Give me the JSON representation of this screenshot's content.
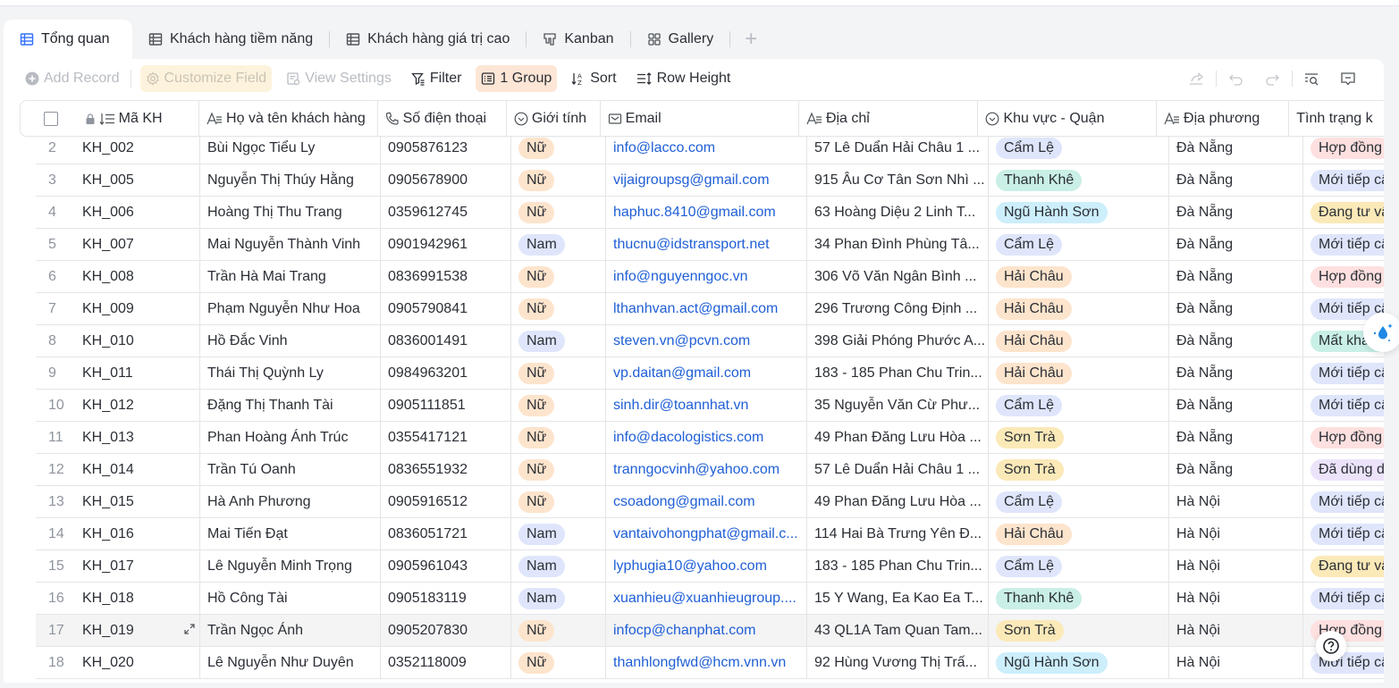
{
  "tabs": [
    {
      "label": "Tổng quan",
      "icon": "grid-table-icon",
      "active": true
    },
    {
      "label": "Khách hàng tiềm năng",
      "icon": "grid-table-icon"
    },
    {
      "label": "Khách hàng giá trị cao",
      "icon": "grid-table-icon"
    },
    {
      "label": "Kanban",
      "icon": "kanban-icon"
    },
    {
      "label": "Gallery",
      "icon": "gallery-icon"
    }
  ],
  "add_tab_label": "+",
  "toolbar": {
    "add_record": "Add Record",
    "customize_field": "Customize Field",
    "view_settings": "View Settings",
    "filter": "Filter",
    "group": "1 Group",
    "sort": "Sort",
    "row_height": "Row Height"
  },
  "columns": {
    "code": "Mã KH",
    "name": "Họ và tên khách hàng",
    "phone": "Số điện thoại",
    "gender": "Giới tính",
    "email": "Email",
    "address": "Địa chỉ",
    "district": "Khu vực - Quận",
    "locality": "Địa phương",
    "status": "Tình trạng k"
  },
  "tag_colors": {
    "Nữ": "#fde4cc",
    "Nam": "#dfe6fb",
    "Cẩm Lệ": "#dfe6fb",
    "Thanh Khê": "#c9efe6",
    "Ngũ Hành Sơn": "#cdeefb",
    "Hải Châu": "#fde4cc",
    "Sơn Trà": "#fbe9b8",
    "Hợp đồng": "#fde0df",
    "Mới tiếp cậ": "#dfe6fb",
    "Đang tư vấ": "#fbe9b8",
    "Mất khách": "#c9efe6",
    "Đã dùng d": "#ece3fb"
  },
  "rows": [
    {
      "n": "2",
      "code": "KH_002",
      "name": "Bùi Ngọc Tiểu Ly",
      "phone": "0905876123",
      "gender": "Nữ",
      "email": "info@lacco.com",
      "address": "57 Lê Duẩn Hải Châu 1 ...",
      "district": "Cẩm Lệ",
      "locality": "Đà Nẵng",
      "status": "Hợp đồng"
    },
    {
      "n": "3",
      "code": "KH_005",
      "name": "Nguyễn Thị Thúy Hằng",
      "phone": "0905678900",
      "gender": "Nữ",
      "email": "vijaigroupsg@gmail.com",
      "address": "915 Âu Cơ Tân Sơn Nhì ...",
      "district": "Thanh Khê",
      "locality": "Đà Nẵng",
      "status": "Mới tiếp cậ"
    },
    {
      "n": "4",
      "code": "KH_006",
      "name": "Hoàng Thị Thu Trang",
      "phone": "0359612745",
      "gender": "Nữ",
      "email": "haphuc.8410@gmail.com",
      "address": "63 Hoàng Diệu 2 Linh T...",
      "district": "Ngũ Hành Sơn",
      "locality": "Đà Nẵng",
      "status": "Đang tư vấ"
    },
    {
      "n": "5",
      "code": "KH_007",
      "name": "Mai Nguyễn Thành Vinh",
      "phone": "0901942961",
      "gender": "Nam",
      "email": "thucnu@idstransport.net",
      "address": "34 Phan Đình Phùng Tâ...",
      "district": "Cẩm Lệ",
      "locality": "Đà Nẵng",
      "status": "Mới tiếp cậ"
    },
    {
      "n": "6",
      "code": "KH_008",
      "name": "Trần Hà Mai Trang",
      "phone": "0836991538",
      "gender": "Nữ",
      "email": "info@nguyenngoc.vn",
      "address": "306 Võ Văn Ngân Bình ...",
      "district": "Hải Châu",
      "locality": "Đà Nẵng",
      "status": "Hợp đồng"
    },
    {
      "n": "7",
      "code": "KH_009",
      "name": "Phạm Nguyễn Như Hoa",
      "phone": "0905790841",
      "gender": "Nữ",
      "email": "lthanhvan.act@gmail.com",
      "address": "296 Trương Công Định ...",
      "district": "Hải Châu",
      "locality": "Đà Nẵng",
      "status": "Mới tiếp cậ"
    },
    {
      "n": "8",
      "code": "KH_010",
      "name": "Hồ Đắc Vinh",
      "phone": "0836001491",
      "gender": "Nam",
      "email": "steven.vn@pcvn.com",
      "address": "398 Giải Phóng Phước A...",
      "district": "Hải Châu",
      "locality": "Đà Nẵng",
      "status": "Mất khách"
    },
    {
      "n": "9",
      "code": "KH_011",
      "name": "Thái Thị Quỳnh Ly",
      "phone": "0984963201",
      "gender": "Nữ",
      "email": "vp.daitan@gmail.com",
      "address": "183 - 185 Phan Chu Trin...",
      "district": "Hải Châu",
      "locality": "Đà Nẵng",
      "status": "Mới tiếp cậ"
    },
    {
      "n": "10",
      "code": "KH_012",
      "name": "Đặng Thị Thanh Tài",
      "phone": "0905111851",
      "gender": "Nữ",
      "email": "sinh.dir@toannhat.vn",
      "address": "35 Nguyễn Văn Cừ Phư...",
      "district": "Cẩm Lệ",
      "locality": "Đà Nẵng",
      "status": "Mới tiếp cậ"
    },
    {
      "n": "11",
      "code": "KH_013",
      "name": "Phan Hoàng Ánh Trúc",
      "phone": "0355417121",
      "gender": "Nữ",
      "email": "info@dacologistics.com",
      "address": "49 Phan Đăng Lưu Hòa ...",
      "district": "Sơn Trà",
      "locality": "Đà Nẵng",
      "status": "Hợp đồng"
    },
    {
      "n": "12",
      "code": "KH_014",
      "name": "Trần Tú Oanh",
      "phone": "0836551932",
      "gender": "Nữ",
      "email": "tranngocvinh@yahoo.com",
      "address": "57 Lê Duẩn Hải Châu 1 ...",
      "district": "Sơn Trà",
      "locality": "Đà Nẵng",
      "status": "Đã dùng d"
    },
    {
      "n": "13",
      "code": "KH_015",
      "name": "Hà Anh Phương",
      "phone": "0905916512",
      "gender": "Nữ",
      "email": "csoadong@gmail.com",
      "address": "49 Phan Đăng Lưu Hòa ...",
      "district": "Cẩm Lệ",
      "locality": "Hà Nội",
      "status": "Mới tiếp cậ"
    },
    {
      "n": "14",
      "code": "KH_016",
      "name": "Mai Tiến Đạt",
      "phone": "0836051721",
      "gender": "Nam",
      "email": "vantaivohongphat@gmail.c...",
      "address": "114 Hai Bà Trưng Yên Đ...",
      "district": "Hải Châu",
      "locality": "Hà Nội",
      "status": "Mới tiếp cậ"
    },
    {
      "n": "15",
      "code": "KH_017",
      "name": "Lê Nguyễn Minh Trọng",
      "phone": "0905961043",
      "gender": "Nam",
      "email": "lyphugia10@yahoo.com",
      "address": "183 - 185 Phan Chu Trin...",
      "district": "Cẩm Lệ",
      "locality": "Hà Nội",
      "status": "Đang tư vấ"
    },
    {
      "n": "16",
      "code": "KH_018",
      "name": "Hồ Công Tài",
      "phone": "0905183119",
      "gender": "Nam",
      "email": "xuanhieu@xuanhieugroup....",
      "address": "15 Y Wang, Ea Kao Ea T...",
      "district": "Thanh Khê",
      "locality": "Hà Nội",
      "status": "Mới tiếp cậ"
    },
    {
      "n": "17",
      "code": "KH_019",
      "name": "Trần Ngọc Ánh",
      "phone": "0905207830",
      "gender": "Nữ",
      "email": "infocp@chanphat.com",
      "address": "43 QL1A Tam Quan Tam...",
      "district": "Sơn Trà",
      "locality": "Hà Nội",
      "status": "Hợp đồng",
      "hover": true
    },
    {
      "n": "18",
      "code": "KH_020",
      "name": "Lê Nguyễn Như Duyên",
      "phone": "0352118009",
      "gender": "Nữ",
      "email": "thanhlongfwd@hcm.vnn.vn",
      "address": "92 Hùng Vương Thị Trấ...",
      "district": "Ngũ Hành Sơn",
      "locality": "Hà Nội",
      "status": "Mới tiếp cậ"
    }
  ]
}
